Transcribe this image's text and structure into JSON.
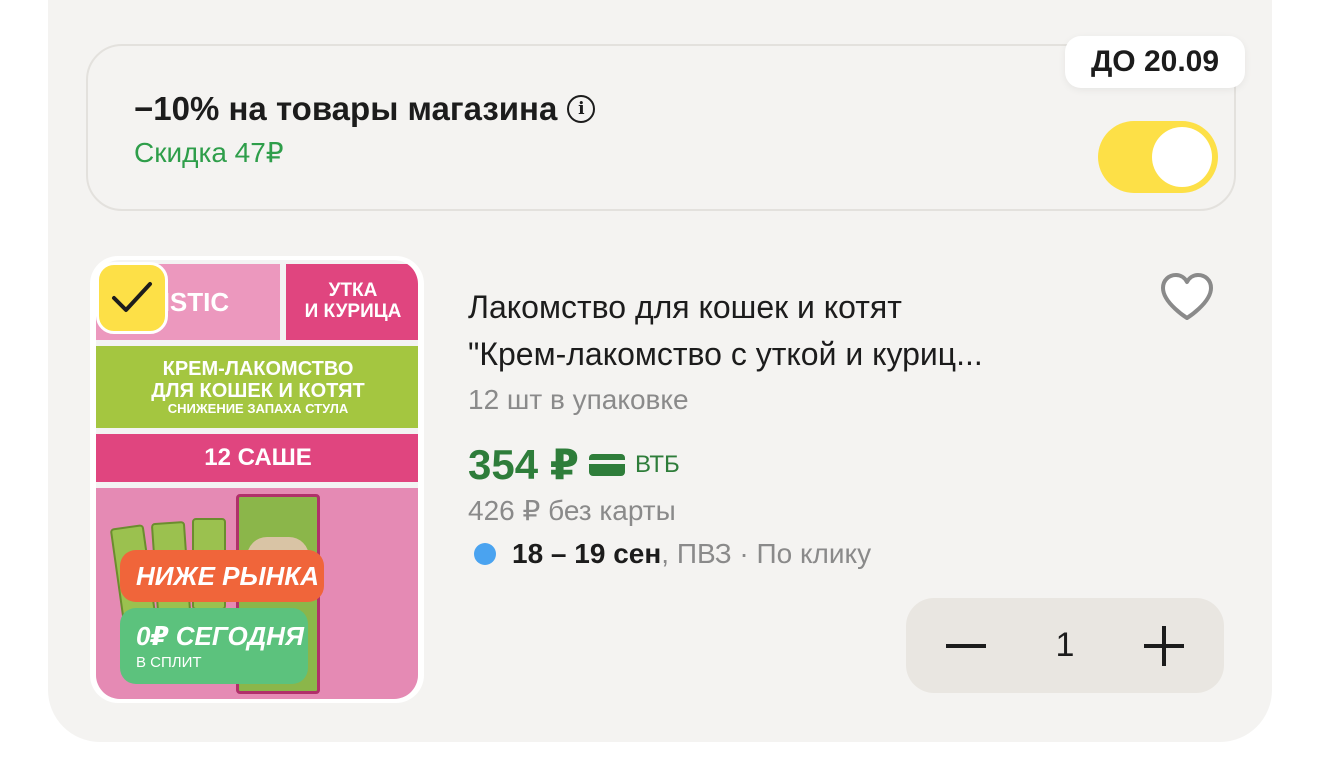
{
  "promo": {
    "title": "−10% на товары магазина",
    "info_icon": "info-icon",
    "discount": "Скидка 47₽",
    "until": "ДО 20.09",
    "toggle_on": true,
    "accent": "#fde047",
    "discount_color": "#2e9e4a"
  },
  "product": {
    "image_labels": {
      "holistic": "LISTIC",
      "duck_chicken": "УТКА\nИ КУРИЦА",
      "cream_line1": "КРЕМ-ЛАКОМСТВО",
      "cream_line2": "ДЛЯ КОШЕК И КОТЯТ",
      "cream_line3": "СНИЖЕНИЕ ЗАПАХА СТУЛА",
      "sachet": "12 САШЕ",
      "tag_market": "НИЖЕ РЫНКА",
      "tag_split": "0₽ СЕГОДНЯ",
      "tag_split_sub": "В СПЛИТ"
    },
    "selected": true,
    "title_line1": "Лакомство для кошек и котят",
    "title_line2": "\"Крем-лакомство с уткой и куриц...",
    "pack_qty": "12 шт в упаковке",
    "price": "354 ₽",
    "bank": "ВТБ",
    "old_price": "426 ₽ без карты",
    "delivery_date": "18 – 19 сен",
    "delivery_rest": ", ПВЗ · По клику",
    "favorite_icon": "heart-icon",
    "price_color": "#2e7d3a"
  },
  "stepper": {
    "quantity": "1"
  }
}
